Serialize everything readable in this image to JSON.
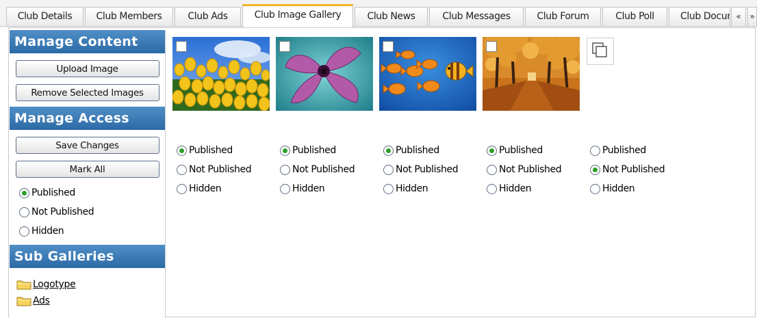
{
  "tabs": [
    {
      "label": "Club Details"
    },
    {
      "label": "Club Members"
    },
    {
      "label": "Club Ads"
    },
    {
      "label": "Club Image Gallery",
      "active": true
    },
    {
      "label": "Club News"
    },
    {
      "label": "Club Messages"
    },
    {
      "label": "Club Forum"
    },
    {
      "label": "Club Poll"
    },
    {
      "label": "Club Documents"
    }
  ],
  "tab_scroll": {
    "left": "«",
    "right": "»"
  },
  "sidebar": {
    "manage_content": {
      "title": "Manage Content",
      "upload_label": "Upload Image",
      "remove_label": "Remove Selected Images"
    },
    "manage_access": {
      "title": "Manage Access",
      "save_label": "Save Changes",
      "mark_all_label": "Mark All",
      "options": [
        "Published",
        "Not Published",
        "Hidden"
      ],
      "selected": "Published"
    },
    "sub_galleries": {
      "title": "Sub Galleries",
      "items": [
        "Logotype",
        "Ads"
      ]
    }
  },
  "gallery": {
    "option_labels": [
      "Published",
      "Not Published",
      "Hidden"
    ],
    "images": [
      {
        "subject": "yellow tulips against blue sky",
        "status": "Published"
      },
      {
        "subject": "purple cyclamen flower on teal",
        "status": "Published"
      },
      {
        "subject": "orange fish on blue background",
        "status": "Published"
      },
      {
        "subject": "autumn tree-lined avenue",
        "status": "Published"
      },
      {
        "subject": "empty placeholder",
        "status": "Not Published"
      }
    ]
  },
  "colors": {
    "header_blue": "#2c6aa6",
    "active_tab_accent": "#f0b323",
    "radio_selected": "#2aa12a"
  }
}
